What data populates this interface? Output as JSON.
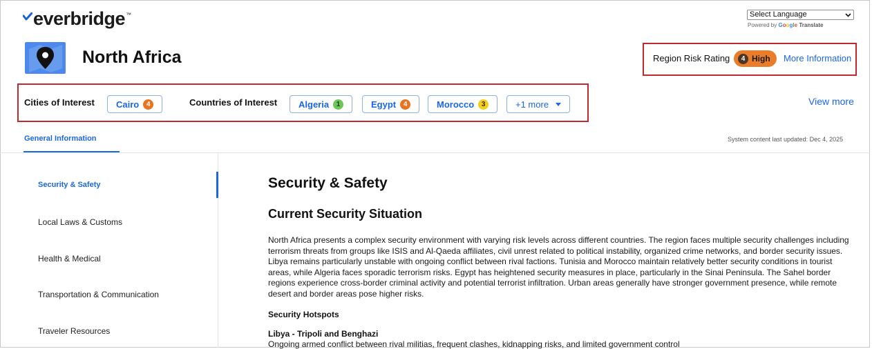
{
  "brand": {
    "logo_text": "everbridge",
    "trademark": "™"
  },
  "translate": {
    "select_label": "Select Language",
    "powered_by": "Powered by",
    "google_letters": [
      "G",
      "o",
      "o",
      "g",
      "l",
      "e"
    ],
    "translate_word": "Translate"
  },
  "region": {
    "name": "North Africa",
    "icon": "map-pin-icon"
  },
  "risk": {
    "label": "Region Risk Rating",
    "level": "4",
    "level_text": "High",
    "more_info": "More Information",
    "accent": "#ea7d2a"
  },
  "interest": {
    "cities_label": "Cities of Interest",
    "cities": [
      {
        "name": "Cairo",
        "level": "4"
      }
    ],
    "countries_label": "Countries of Interest",
    "countries": [
      {
        "name": "Algeria",
        "level": "1"
      },
      {
        "name": "Egypt",
        "level": "4"
      },
      {
        "name": "Morocco",
        "level": "3"
      }
    ],
    "more_label": "+1 more",
    "view_more": "View more"
  },
  "tabs": {
    "active": "General Information",
    "updated": "System content last updated: Dec 4, 2025"
  },
  "sidenav": {
    "items": [
      {
        "label": "Security & Safety"
      },
      {
        "label": "Local Laws & Customs"
      },
      {
        "label": "Health & Medical"
      },
      {
        "label": "Transportation & Communication"
      },
      {
        "label": "Traveler Resources"
      }
    ]
  },
  "content": {
    "title": "Security & Safety",
    "section_title": "Current Security Situation",
    "paragraph": "North Africa presents a complex security environment with varying risk levels across different countries. The region faces multiple security challenges including terrorism threats from groups like ISIS and Al-Qaeda affiliates, civil unrest related to political instability, organized crime networks, and border security issues. Libya remains particularly unstable with ongoing conflict between rival factions. Tunisia and Morocco maintain relatively better security conditions in tourist areas, while Algeria faces sporadic terrorism risks. Egypt has heightened security measures in place, particularly in the Sinai Peninsula. The Sahel border regions experience cross-border criminal activity and potential terrorist infiltration. Urban areas generally have stronger government presence, while remote desert and border areas pose higher risks.",
    "hotspots_title": "Security Hotspots",
    "hotspot_name": "Libya - Tripoli and Benghazi",
    "hotspot_desc": "Ongoing armed conflict between rival militias, frequent clashes, kidnapping risks, and limited government control"
  }
}
